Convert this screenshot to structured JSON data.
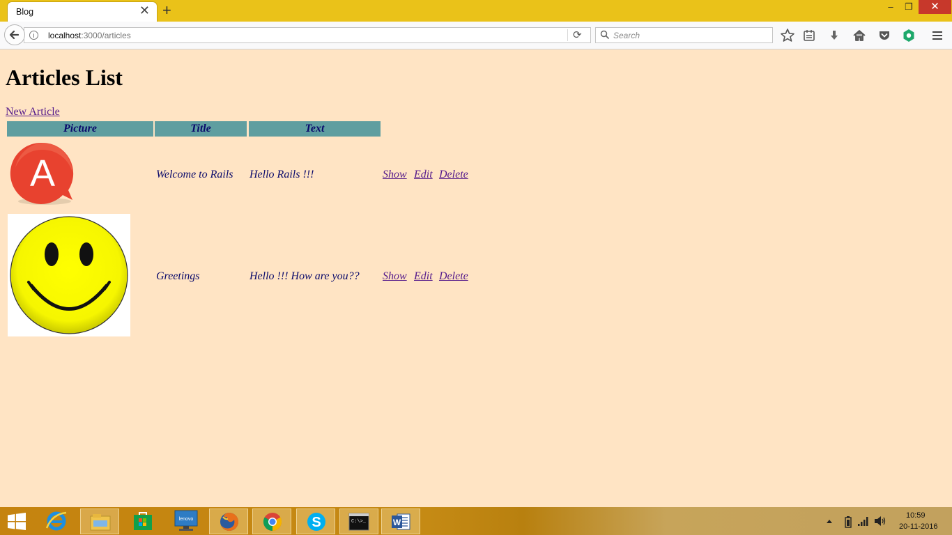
{
  "browser": {
    "tab_title": "Blog",
    "tab_close": "✕",
    "new_tab": "+",
    "url_host": "localhost",
    "url_path": ":3000/articles",
    "search_placeholder": "Search",
    "window_min": "‒",
    "window_restore": "❐",
    "window_close": "✕"
  },
  "page": {
    "title": "Articles List",
    "new_article_link": "New Article",
    "table_headers": {
      "picture": "Picture",
      "title": "Title",
      "text": "Text"
    },
    "articles": [
      {
        "picture_icon": "letter-a-badge-image",
        "picture_letter": "A",
        "title": "Welcome to Rails",
        "text": "Hello Rails !!!",
        "actions": {
          "show": "Show",
          "edit": "Edit",
          "delete": "Delete"
        }
      },
      {
        "picture_icon": "smiley-face-image",
        "title": "Greetings",
        "text": "Hello !!! How are you??",
        "actions": {
          "show": "Show",
          "edit": "Edit",
          "delete": "Delete"
        }
      }
    ]
  },
  "taskbar": {
    "apps": [
      "windows-start-icon",
      "internet-explorer-icon",
      "file-explorer-icon",
      "store-icon",
      "lenovo-icon",
      "firefox-icon",
      "chrome-icon",
      "skype-icon",
      "command-prompt-icon",
      "word-icon"
    ],
    "lenovo_label": "lenovo",
    "cmd_label": "C:\\>_",
    "clock_time": "10:59",
    "clock_date": "20-11-2016"
  },
  "colors": {
    "titlebar": "#EAC219",
    "page_background": "#FFE4C4",
    "table_header_bg": "#5F9EA0",
    "table_text": "#0A0A6B",
    "link_visited": "#551A8B",
    "close_button": "#C7382B"
  }
}
